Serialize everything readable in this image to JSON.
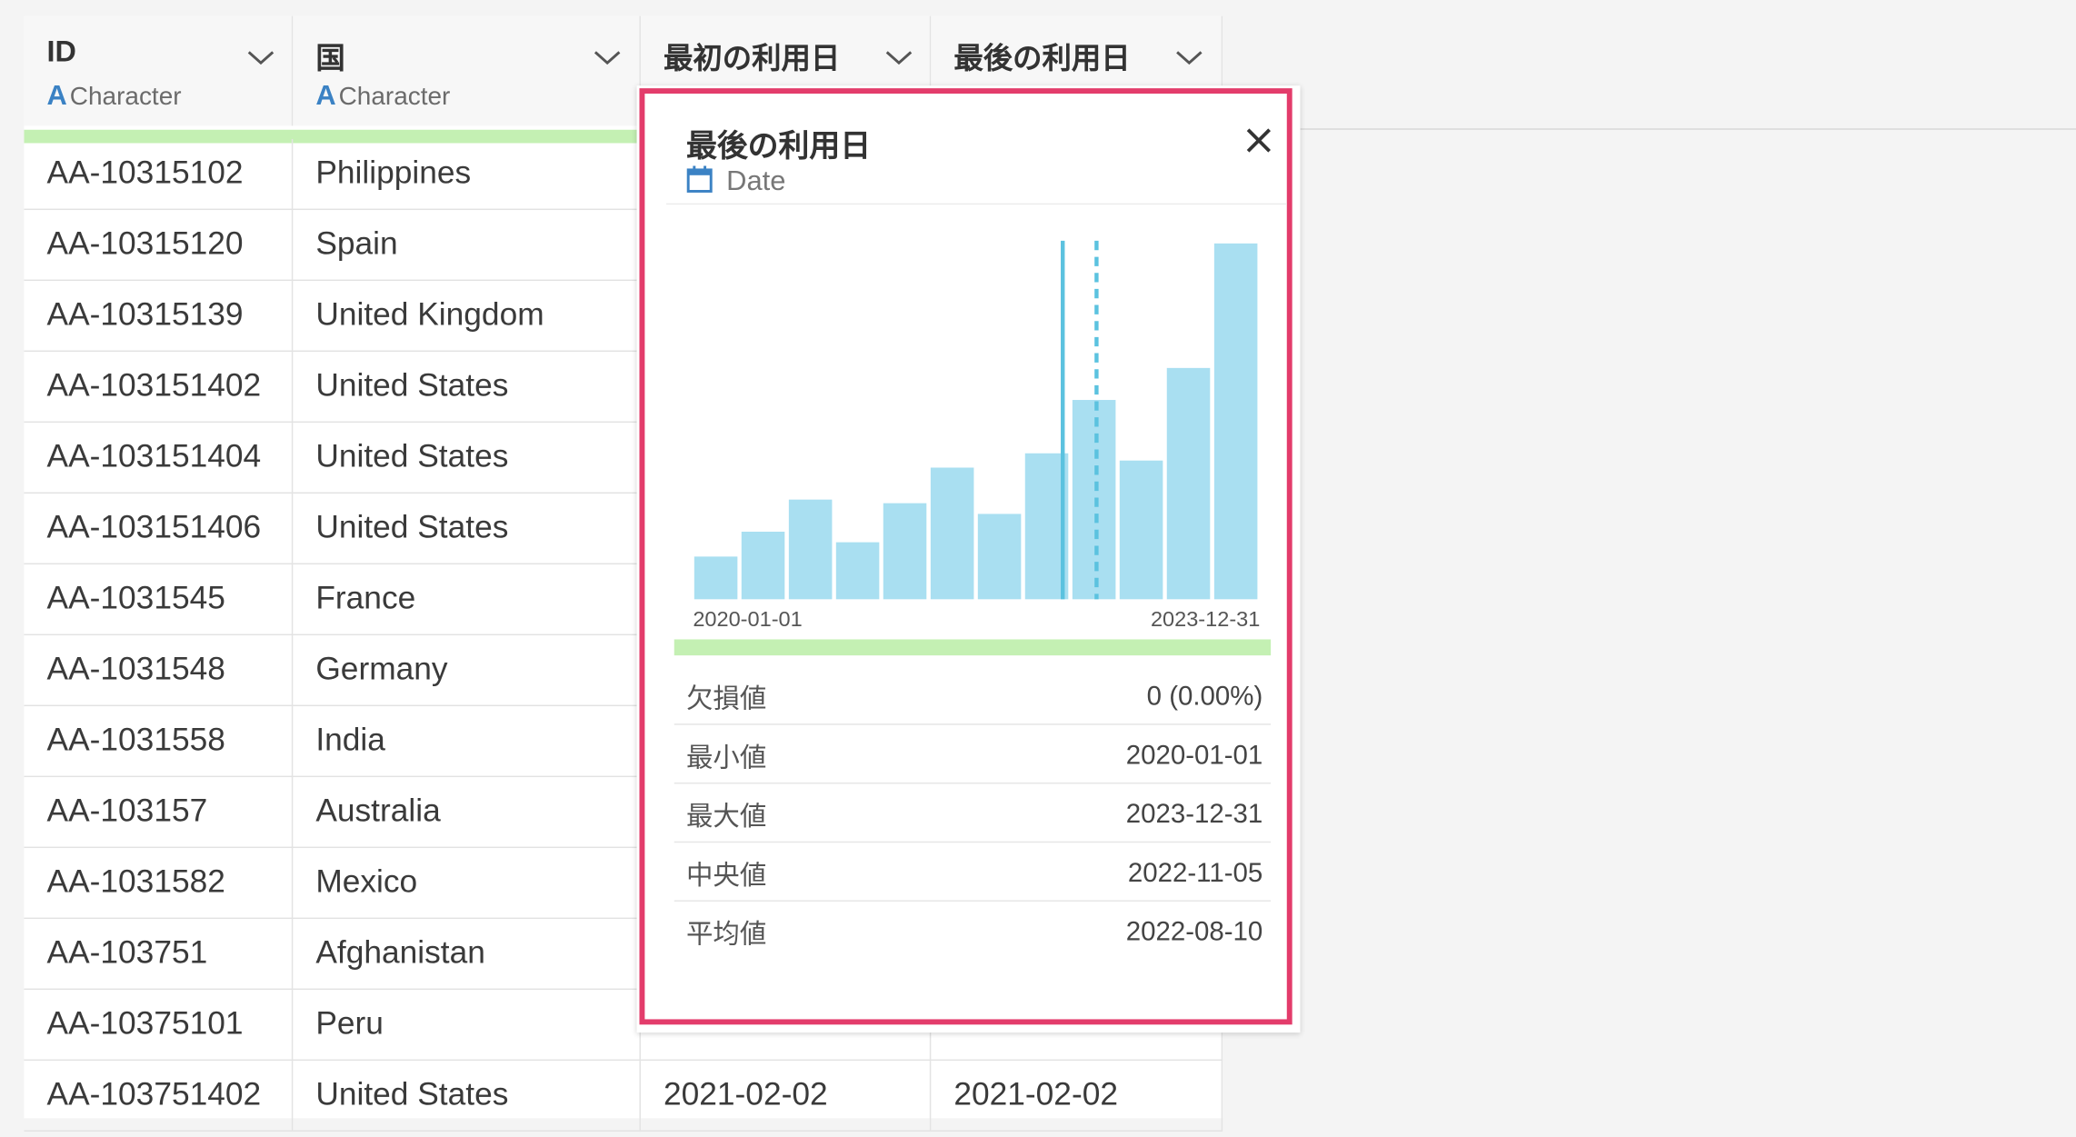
{
  "columns": [
    {
      "title": "ID",
      "type": "Character",
      "type_icon": "A"
    },
    {
      "title": "国",
      "type": "Character",
      "type_icon": "A"
    },
    {
      "title": "最初の利用日",
      "type": "",
      "type_icon": ""
    },
    {
      "title": "最後の利用日",
      "type": "",
      "type_icon": ""
    }
  ],
  "rows": [
    {
      "id": "AA-10315102",
      "country": "Philippines",
      "first": "",
      "last": ""
    },
    {
      "id": "AA-10315120",
      "country": "Spain",
      "first": "",
      "last": ""
    },
    {
      "id": "AA-10315139",
      "country": "United Kingdom",
      "first": "",
      "last": ""
    },
    {
      "id": "AA-103151402",
      "country": "United States",
      "first": "",
      "last": ""
    },
    {
      "id": "AA-103151404",
      "country": "United States",
      "first": "",
      "last": ""
    },
    {
      "id": "AA-103151406",
      "country": "United States",
      "first": "",
      "last": ""
    },
    {
      "id": "AA-1031545",
      "country": "France",
      "first": "",
      "last": ""
    },
    {
      "id": "AA-1031548",
      "country": "Germany",
      "first": "",
      "last": ""
    },
    {
      "id": "AA-1031558",
      "country": "India",
      "first": "",
      "last": ""
    },
    {
      "id": "AA-103157",
      "country": "Australia",
      "first": "",
      "last": ""
    },
    {
      "id": "AA-1031582",
      "country": "Mexico",
      "first": "",
      "last": ""
    },
    {
      "id": "AA-103751",
      "country": "Afghanistan",
      "first": "",
      "last": ""
    },
    {
      "id": "AA-10375101",
      "country": "Peru",
      "first": "",
      "last": ""
    },
    {
      "id": "AA-103751402",
      "country": "United States",
      "first": "2021-02-02",
      "last": "2021-02-02"
    }
  ],
  "popup": {
    "title": "最後の利用日",
    "type": "Date",
    "type_icon": "calendar-icon",
    "stats": [
      {
        "label": "欠損値",
        "value": "0 (0.00%)"
      },
      {
        "label": "最小値",
        "value": "2020-01-01"
      },
      {
        "label": "最大値",
        "value": "2023-12-31"
      },
      {
        "label": "中央値",
        "value": "2022-11-05"
      },
      {
        "label": "平均値",
        "value": "2022-08-10"
      }
    ]
  },
  "chart_data": {
    "type": "bar",
    "x_start": "2020-01-01",
    "x_end": "2023-12-31",
    "bin_heights_relative": [
      0.12,
      0.19,
      0.28,
      0.16,
      0.27,
      0.37,
      0.24,
      0.41,
      0.56,
      0.39,
      0.65,
      1.0
    ],
    "median_marker": "2022-11-05",
    "mean_marker": "2022-08-10",
    "grid": false
  },
  "colors": {
    "accent_border": "#e33c6b",
    "bar_fill": "#a9dff1",
    "marker": "#5bc2df",
    "quality_bar": "#c4f0b3",
    "type_icon": "#3b82c4"
  }
}
